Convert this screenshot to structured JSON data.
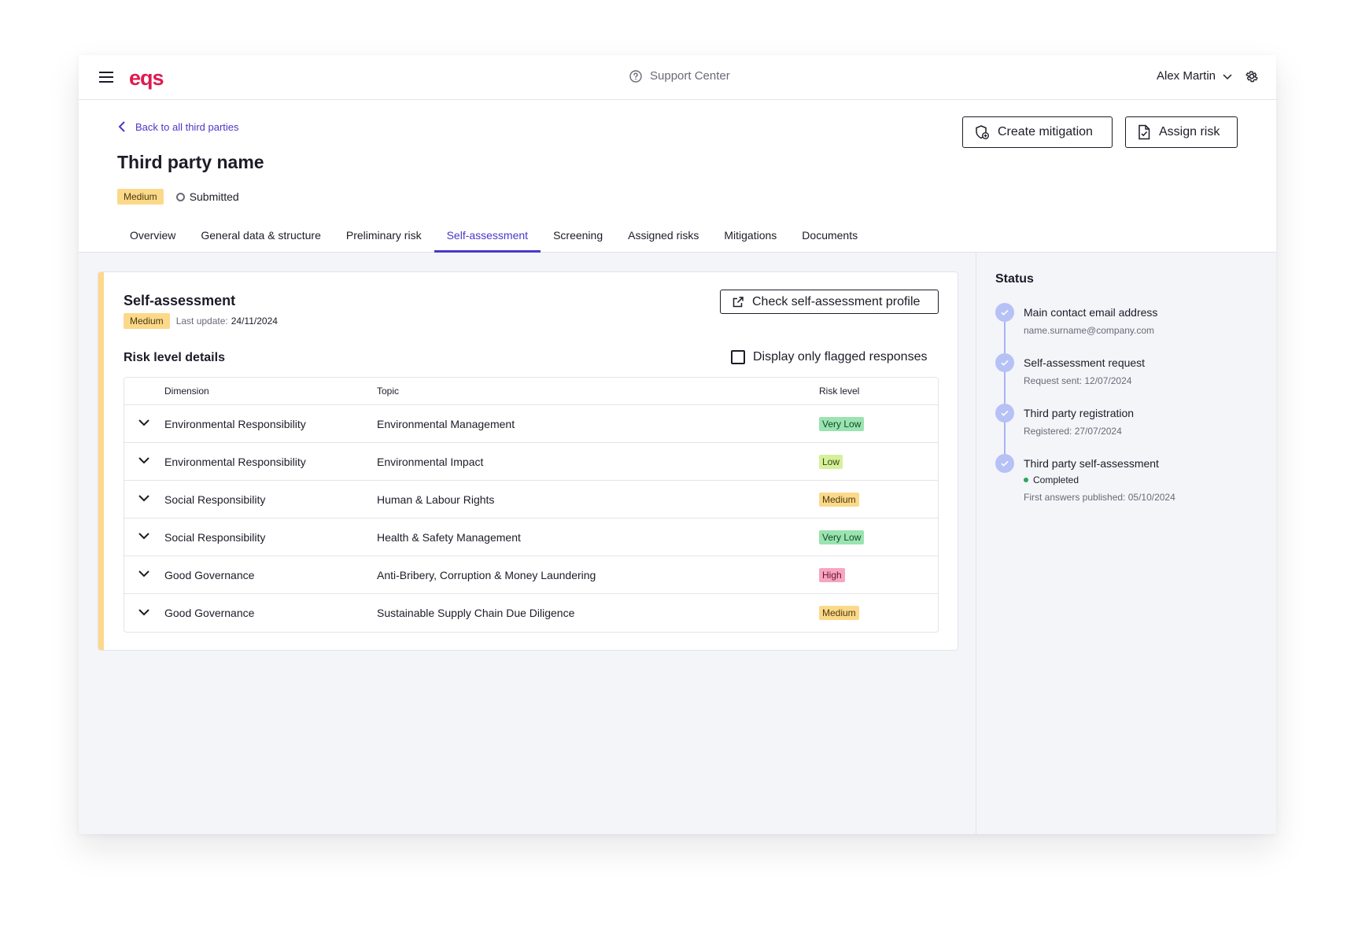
{
  "app": {
    "logo": "eqs",
    "support_label": "Support Center",
    "user_name": "Alex Martin"
  },
  "header": {
    "back_label": "Back to all third parties",
    "title": "Third party name",
    "risk_badge": "Medium",
    "status": "Submitted",
    "create_mitigation_label": "Create mitigation",
    "assign_risk_label": "Assign risk"
  },
  "tabs": [
    {
      "label": "Overview"
    },
    {
      "label": "General data & structure"
    },
    {
      "label": "Preliminary risk"
    },
    {
      "label": "Self-assessment",
      "active": true
    },
    {
      "label": "Screening"
    },
    {
      "label": "Assigned risks"
    },
    {
      "label": "Mitigations"
    },
    {
      "label": "Documents"
    }
  ],
  "card": {
    "title": "Self-assessment",
    "badge": "Medium",
    "last_update_label": "Last update:",
    "last_update_date": "24/11/2024",
    "check_profile_label": "Check self-assessment profile",
    "risk_details_title": "Risk level details",
    "flagged_label": "Display only flagged responses",
    "columns": {
      "dimension": "Dimension",
      "topic": "Topic",
      "risk": "Risk level"
    },
    "rows": [
      {
        "dimension": "Environmental Responsibility",
        "topic": "Environmental Management",
        "risk": "Very Low"
      },
      {
        "dimension": "Environmental Responsibility",
        "topic": "Environmental Impact",
        "risk": "Low"
      },
      {
        "dimension": "Social Responsibility",
        "topic": "Human & Labour Rights",
        "risk": "Medium"
      },
      {
        "dimension": "Social Responsibility",
        "topic": "Health & Safety Management",
        "risk": "Very Low"
      },
      {
        "dimension": "Good Governance",
        "topic": "Anti-Bribery, Corruption & Money Laundering",
        "risk": "High"
      },
      {
        "dimension": "Good Governance",
        "topic": "Sustainable Supply Chain Due Diligence",
        "risk": "Medium"
      }
    ]
  },
  "risk_colors": {
    "Very Low": {
      "bg": "#9be3b0",
      "fg": "#0f4a24"
    },
    "Low": {
      "bg": "#d6f09a",
      "fg": "#34450c"
    },
    "Medium": {
      "bg": "#fcd98a",
      "fg": "#4a3a10"
    },
    "High": {
      "bg": "#f7a6c0",
      "fg": "#6a1230"
    }
  },
  "status_panel": {
    "title": "Status",
    "steps": [
      {
        "label": "Main contact email address",
        "sub": "name.surname@company.com"
      },
      {
        "label": "Self-assessment request",
        "sub": "Request sent: 12/07/2024"
      },
      {
        "label": "Third party registration",
        "sub": "Registered: 27/07/2024"
      },
      {
        "label": "Third party self-assessment",
        "state": "Completed",
        "sub": "First answers published: 05/10/2024"
      }
    ]
  }
}
